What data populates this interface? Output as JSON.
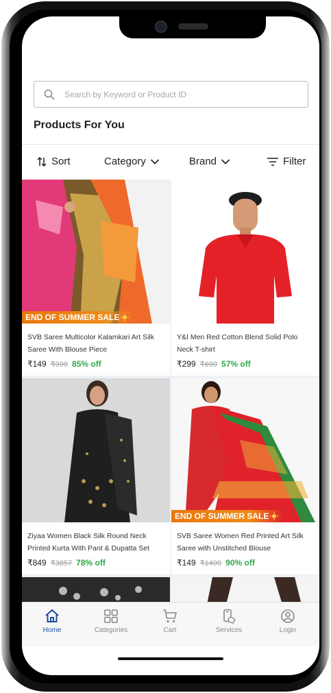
{
  "search": {
    "placeholder": "Search by Keyword or Product ID"
  },
  "section_title": "Products For You",
  "toolbar": {
    "sort": "Sort",
    "category": "Category",
    "brand": "Brand",
    "filter": "Filter"
  },
  "products": [
    {
      "title": "SVB Saree Multicolor Kalamkari Art Silk Saree With Blouse Piece",
      "price": "₹149",
      "mrp": "₹999",
      "off": "85% off",
      "banner": "END OF SUMMER SALE",
      "image": "multicolor silk saree"
    },
    {
      "title": "Y&I Men Red Cotton Blend Solid Polo Neck T-shirt",
      "price": "₹299",
      "mrp": "₹699",
      "off": "57% off",
      "banner": "",
      "image": "man in red polo t-shirt"
    },
    {
      "title": "Ziyaa Women Black Silk Round Neck Printed Kurta With Pant & Dupatta Set",
      "price": "₹849",
      "mrp": "₹3857",
      "off": "78% off",
      "banner": "",
      "image": "woman in black kurta set"
    },
    {
      "title": "SVB Saree Women Red Printed Art Silk Saree with Unstitched Blouse",
      "price": "₹149",
      "mrp": "₹1499",
      "off": "90% off",
      "banner": "END OF SUMMER SALE",
      "image": "red printed silk saree"
    }
  ],
  "nav": {
    "home": "Home",
    "categories": "Categories",
    "cart": "Cart",
    "services": "Services",
    "login": "Login"
  },
  "colors": {
    "accent": "#1b4e9b",
    "discount": "#2eaa4a",
    "sale_banner": "#e9770e"
  }
}
